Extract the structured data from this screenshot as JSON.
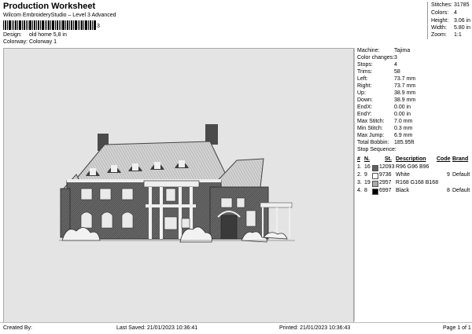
{
  "header": {
    "title": "Production Worksheet",
    "subtitle": "Wilcom EmbroideryStudio – Level 3 Advanced",
    "barcode_number": "3",
    "design_label": "Design:",
    "design_value": "old home 5,8 in",
    "colorway_label": "Colorway:",
    "colorway_value": "Colorway 1"
  },
  "stats": [
    {
      "label": "Stitches:",
      "value": "31785"
    },
    {
      "label": "Colors:",
      "value": "4"
    },
    {
      "label": "Height:",
      "value": "3.06 in"
    },
    {
      "label": "Width:",
      "value": "5.80 in"
    },
    {
      "label": "Zoom:",
      "value": "1:1"
    }
  ],
  "details": [
    {
      "label": "Machine:",
      "value": "Tajima"
    },
    {
      "label": "Color changes:",
      "value": "3"
    },
    {
      "label": "Stops:",
      "value": "4"
    },
    {
      "label": "Trims:",
      "value": "58"
    },
    {
      "label": "Left:",
      "value": "73.7 mm"
    },
    {
      "label": "Right:",
      "value": "73.7 mm"
    },
    {
      "label": "Up:",
      "value": "38.9 mm"
    },
    {
      "label": "Down:",
      "value": "38.9 mm"
    },
    {
      "label": "EndX:",
      "value": "0.00 in"
    },
    {
      "label": "EndY:",
      "value": "0.00 in"
    },
    {
      "label": "Max Stitch:",
      "value": "7.0 mm"
    },
    {
      "label": "Min Stitch:",
      "value": "0.3 mm"
    },
    {
      "label": "Max Jump:",
      "value": "6.9 mm"
    },
    {
      "label": "Total Bobbin:",
      "value": "185.95ft"
    }
  ],
  "sequence": {
    "title": "Stop Sequence:",
    "headers": {
      "num": "#",
      "n": "N.",
      "st": "St.",
      "desc": "Description",
      "code": "Code",
      "brand": "Brand"
    },
    "rows": [
      {
        "num": "1.",
        "n": "16",
        "swatch": "#606060",
        "st": "12093",
        "desc": "R96 G96 B96",
        "code": "",
        "brand": ""
      },
      {
        "num": "2.",
        "n": "9",
        "swatch": "#ffffff",
        "st": "9736",
        "desc": "White",
        "code": "9",
        "brand": "Default"
      },
      {
        "num": "3.",
        "n": "19",
        "swatch": "#a8a8a8",
        "st": "2957",
        "desc": "R168 G168 B168",
        "code": "",
        "brand": ""
      },
      {
        "num": "4.",
        "n": "8",
        "swatch": "#000000",
        "st": "6997",
        "desc": "Black",
        "code": "8",
        "brand": "Default"
      }
    ]
  },
  "footer": {
    "created_by": "Created By:",
    "last_saved": "Last Saved: 21/01/2023 10:36:41",
    "printed": "Printed: 21/01/2023 10:36:43",
    "page": "Page 1 of 1"
  },
  "colors": {
    "canvas_bg": "#e4e4e4",
    "house_brick": "#5a5a5a",
    "roof": "#d0d0d0",
    "trim": "#f2f2f2"
  }
}
